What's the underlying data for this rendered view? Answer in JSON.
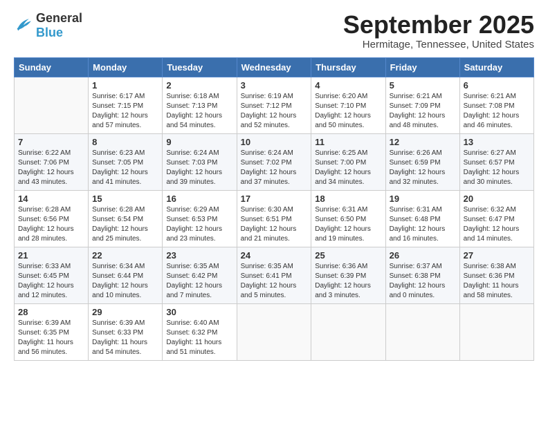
{
  "header": {
    "logo_general": "General",
    "logo_blue": "Blue",
    "month": "September 2025",
    "location": "Hermitage, Tennessee, United States"
  },
  "weekdays": [
    "Sunday",
    "Monday",
    "Tuesday",
    "Wednesday",
    "Thursday",
    "Friday",
    "Saturday"
  ],
  "weeks": [
    [
      {
        "day": "",
        "lines": []
      },
      {
        "day": "1",
        "lines": [
          "Sunrise: 6:17 AM",
          "Sunset: 7:15 PM",
          "Daylight: 12 hours",
          "and 57 minutes."
        ]
      },
      {
        "day": "2",
        "lines": [
          "Sunrise: 6:18 AM",
          "Sunset: 7:13 PM",
          "Daylight: 12 hours",
          "and 54 minutes."
        ]
      },
      {
        "day": "3",
        "lines": [
          "Sunrise: 6:19 AM",
          "Sunset: 7:12 PM",
          "Daylight: 12 hours",
          "and 52 minutes."
        ]
      },
      {
        "day": "4",
        "lines": [
          "Sunrise: 6:20 AM",
          "Sunset: 7:10 PM",
          "Daylight: 12 hours",
          "and 50 minutes."
        ]
      },
      {
        "day": "5",
        "lines": [
          "Sunrise: 6:21 AM",
          "Sunset: 7:09 PM",
          "Daylight: 12 hours",
          "and 48 minutes."
        ]
      },
      {
        "day": "6",
        "lines": [
          "Sunrise: 6:21 AM",
          "Sunset: 7:08 PM",
          "Daylight: 12 hours",
          "and 46 minutes."
        ]
      }
    ],
    [
      {
        "day": "7",
        "lines": [
          "Sunrise: 6:22 AM",
          "Sunset: 7:06 PM",
          "Daylight: 12 hours",
          "and 43 minutes."
        ]
      },
      {
        "day": "8",
        "lines": [
          "Sunrise: 6:23 AM",
          "Sunset: 7:05 PM",
          "Daylight: 12 hours",
          "and 41 minutes."
        ]
      },
      {
        "day": "9",
        "lines": [
          "Sunrise: 6:24 AM",
          "Sunset: 7:03 PM",
          "Daylight: 12 hours",
          "and 39 minutes."
        ]
      },
      {
        "day": "10",
        "lines": [
          "Sunrise: 6:24 AM",
          "Sunset: 7:02 PM",
          "Daylight: 12 hours",
          "and 37 minutes."
        ]
      },
      {
        "day": "11",
        "lines": [
          "Sunrise: 6:25 AM",
          "Sunset: 7:00 PM",
          "Daylight: 12 hours",
          "and 34 minutes."
        ]
      },
      {
        "day": "12",
        "lines": [
          "Sunrise: 6:26 AM",
          "Sunset: 6:59 PM",
          "Daylight: 12 hours",
          "and 32 minutes."
        ]
      },
      {
        "day": "13",
        "lines": [
          "Sunrise: 6:27 AM",
          "Sunset: 6:57 PM",
          "Daylight: 12 hours",
          "and 30 minutes."
        ]
      }
    ],
    [
      {
        "day": "14",
        "lines": [
          "Sunrise: 6:28 AM",
          "Sunset: 6:56 PM",
          "Daylight: 12 hours",
          "and 28 minutes."
        ]
      },
      {
        "day": "15",
        "lines": [
          "Sunrise: 6:28 AM",
          "Sunset: 6:54 PM",
          "Daylight: 12 hours",
          "and 25 minutes."
        ]
      },
      {
        "day": "16",
        "lines": [
          "Sunrise: 6:29 AM",
          "Sunset: 6:53 PM",
          "Daylight: 12 hours",
          "and 23 minutes."
        ]
      },
      {
        "day": "17",
        "lines": [
          "Sunrise: 6:30 AM",
          "Sunset: 6:51 PM",
          "Daylight: 12 hours",
          "and 21 minutes."
        ]
      },
      {
        "day": "18",
        "lines": [
          "Sunrise: 6:31 AM",
          "Sunset: 6:50 PM",
          "Daylight: 12 hours",
          "and 19 minutes."
        ]
      },
      {
        "day": "19",
        "lines": [
          "Sunrise: 6:31 AM",
          "Sunset: 6:48 PM",
          "Daylight: 12 hours",
          "and 16 minutes."
        ]
      },
      {
        "day": "20",
        "lines": [
          "Sunrise: 6:32 AM",
          "Sunset: 6:47 PM",
          "Daylight: 12 hours",
          "and 14 minutes."
        ]
      }
    ],
    [
      {
        "day": "21",
        "lines": [
          "Sunrise: 6:33 AM",
          "Sunset: 6:45 PM",
          "Daylight: 12 hours",
          "and 12 minutes."
        ]
      },
      {
        "day": "22",
        "lines": [
          "Sunrise: 6:34 AM",
          "Sunset: 6:44 PM",
          "Daylight: 12 hours",
          "and 10 minutes."
        ]
      },
      {
        "day": "23",
        "lines": [
          "Sunrise: 6:35 AM",
          "Sunset: 6:42 PM",
          "Daylight: 12 hours",
          "and 7 minutes."
        ]
      },
      {
        "day": "24",
        "lines": [
          "Sunrise: 6:35 AM",
          "Sunset: 6:41 PM",
          "Daylight: 12 hours",
          "and 5 minutes."
        ]
      },
      {
        "day": "25",
        "lines": [
          "Sunrise: 6:36 AM",
          "Sunset: 6:39 PM",
          "Daylight: 12 hours",
          "and 3 minutes."
        ]
      },
      {
        "day": "26",
        "lines": [
          "Sunrise: 6:37 AM",
          "Sunset: 6:38 PM",
          "Daylight: 12 hours",
          "and 0 minutes."
        ]
      },
      {
        "day": "27",
        "lines": [
          "Sunrise: 6:38 AM",
          "Sunset: 6:36 PM",
          "Daylight: 11 hours",
          "and 58 minutes."
        ]
      }
    ],
    [
      {
        "day": "28",
        "lines": [
          "Sunrise: 6:39 AM",
          "Sunset: 6:35 PM",
          "Daylight: 11 hours",
          "and 56 minutes."
        ]
      },
      {
        "day": "29",
        "lines": [
          "Sunrise: 6:39 AM",
          "Sunset: 6:33 PM",
          "Daylight: 11 hours",
          "and 54 minutes."
        ]
      },
      {
        "day": "30",
        "lines": [
          "Sunrise: 6:40 AM",
          "Sunset: 6:32 PM",
          "Daylight: 11 hours",
          "and 51 minutes."
        ]
      },
      {
        "day": "",
        "lines": []
      },
      {
        "day": "",
        "lines": []
      },
      {
        "day": "",
        "lines": []
      },
      {
        "day": "",
        "lines": []
      }
    ]
  ]
}
